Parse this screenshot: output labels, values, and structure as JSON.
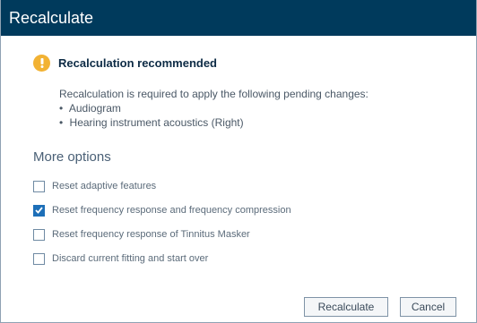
{
  "window": {
    "title": "Recalculate"
  },
  "notice": {
    "icon": "warning-icon",
    "icon_color": "#f2b233",
    "title": "Recalculation recommended",
    "message": "Recalculation is required to apply the following pending changes:",
    "changes": [
      "Audiogram",
      "Hearing instrument acoustics (Right)"
    ]
  },
  "more_options": {
    "title": "More options",
    "options": [
      {
        "label": "Reset adaptive features",
        "checked": false
      },
      {
        "label": "Reset frequency response and frequency compression",
        "checked": true
      },
      {
        "label": "Reset frequency response of Tinnitus Masker",
        "checked": false
      },
      {
        "label": "Discard current fitting and start over",
        "checked": false
      }
    ]
  },
  "buttons": {
    "recalculate_label": "Recalculate",
    "cancel_label": "Cancel"
  },
  "colors": {
    "titlebar": "#003a5c",
    "checkbox_checked": "#1d6fb8"
  }
}
